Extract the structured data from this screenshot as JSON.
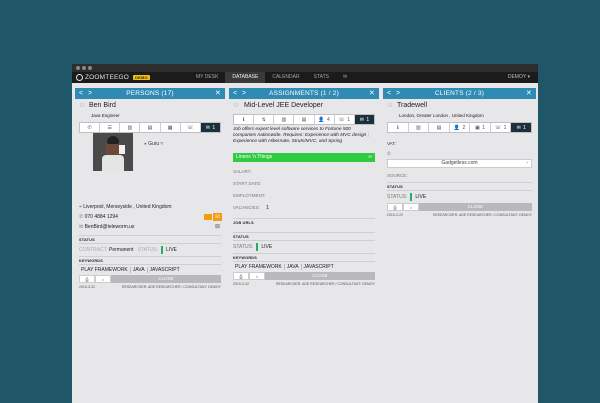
{
  "app": {
    "logo_text": "ZOOMTEEGO",
    "badge": "DEMO",
    "nav": [
      "MY DESK",
      "DATABASE",
      "CALENDAR",
      "STATS",
      "✉"
    ],
    "user_menu": "DEMOY ▾"
  },
  "persons": {
    "header": "PERSONS  (17)",
    "name": "Ben Bird",
    "title": "Java Engineer",
    "tab_badge": "1",
    "photo_caption": "Guru",
    "location": "Liverpool, Merseyside , United Kingdom",
    "phone": "070 4884 1294",
    "email": "BenBird@teleworm.us",
    "status_label": "STATUS",
    "contract_label": "CONTRACT:",
    "contract_value": "Permanent",
    "status_field_label": "STATUS:",
    "status_value": "LIVE",
    "keywords_label": "KEYWORDS",
    "keywords": [
      "PLAY FRAMEWORK",
      "JAVA",
      "JAVASCRIPT"
    ],
    "close": "CLOSE",
    "date": "2015-3-22",
    "footer": "RESEARCHER: ADE RESEARCHER / CONSULTANT: DEMOY"
  },
  "assignments": {
    "header": "ASSIGNMENTS  (1 / 2)",
    "title": "Mid-Level JEE Developer",
    "tabs": [
      "4",
      "1",
      "1"
    ],
    "description": "Job offers expert level software services to Fortune 500 companies nationwide. Requires: Experience with MVC design ; Experience with Hibernate, Struts/MVC, and Spring",
    "client_bar": "Linens 'n Things",
    "fields": [
      "SALARY:",
      "START DATE:",
      "EMPLOYMENT:",
      "VACANCIES:"
    ],
    "vacancies": "1",
    "job_urls": "JOB URLS",
    "status_label": "STATUS",
    "status_field_label": "STATUS:",
    "status_value": "LIVE",
    "keywords_label": "KEYWORDS",
    "keywords": [
      "PLAY FRAMEWORK",
      "JAVA",
      "JAVASCRIPT"
    ],
    "close": "CLOSE",
    "date": "2015-3-22",
    "footer": "RESEARCHER: ADE RESEARCHER / CONSULTANT: DEMOY"
  },
  "clients": {
    "header": "CLIENTS  (2 / 3)",
    "name": "Tradewell",
    "location": "London, Greater London , United Kingdom",
    "tabs": [
      "2",
      "1",
      "1",
      "1"
    ],
    "vat_label": "VAT:",
    "website": "Gadgetless.com",
    "source_label": "SOURCE:",
    "status_label": "STATUS",
    "status_field_label": "STATUS:",
    "status_value": "LIVE",
    "close": "CLOSE",
    "date": "2015-3-22",
    "footer": "RESEARCHER: ADE RESEARCHER / CONSULTANT: DEMOY"
  },
  "colors": {
    "background": "#205768",
    "panel_header": "#2f8ab4",
    "active_tab": "#1b2f3d",
    "status_green": "#27ae60",
    "client_bar": "#2ecc40",
    "badge_yellow": "#f1c40f"
  }
}
